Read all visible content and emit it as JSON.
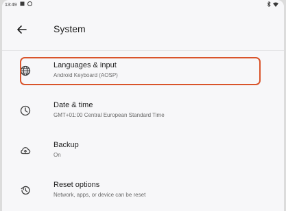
{
  "status_bar": {
    "time": "13:49",
    "left_icons": [
      "notification-icon",
      "notification-icon"
    ],
    "right_icons": [
      "bluetooth-icon",
      "wifi-icon"
    ]
  },
  "appbar": {
    "back_icon": "arrow-left-icon",
    "title": "System"
  },
  "settings": [
    {
      "icon": "globe-icon",
      "label": "Languages & input",
      "sub": "Android Keyboard (AOSP)",
      "highlighted": true
    },
    {
      "icon": "clock-icon",
      "label": "Date & time",
      "sub": "GMT+01:00 Central European Standard Time"
    },
    {
      "icon": "cloud-upload-icon",
      "label": "Backup",
      "sub": "On"
    },
    {
      "icon": "history-icon",
      "label": "Reset options",
      "sub": "Network, apps, or device can be reset"
    }
  ],
  "colors": {
    "highlight": "#d9542b",
    "background": "#f7f7f9",
    "text": "#1f1f1f",
    "subtext": "#6a6a6a"
  }
}
